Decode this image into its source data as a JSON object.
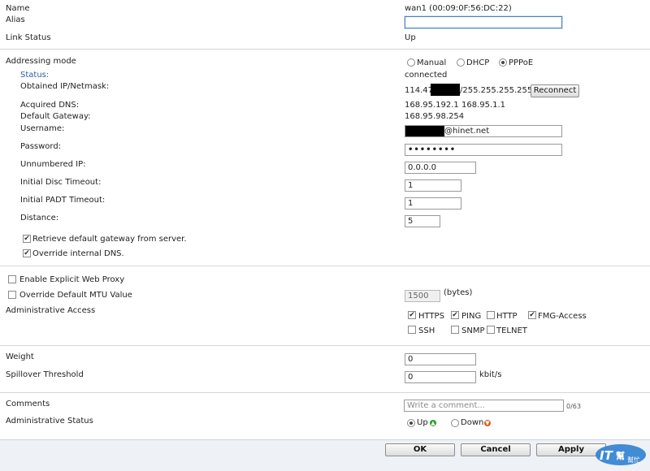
{
  "iface": {
    "name_label": "Name",
    "name_value": "wan1 (00:09:0F:56:DC:22)",
    "alias_label": "Alias",
    "alias_value": "",
    "link_label": "Link Status",
    "link_value": "Up"
  },
  "addressing": {
    "label": "Addressing mode",
    "modes": [
      "Manual",
      "DHCP",
      "PPPoE"
    ],
    "selected": "PPPoE",
    "status_label": "Status:",
    "status_value": "connected",
    "obtained_label": "Obtained IP/Netmask:",
    "obtained_prefix": "114.47.",
    "obtained_suffix": "/255.255.255.255",
    "reconnect_label": "Reconnect",
    "dns_label": "Acquired DNS:",
    "dns_value": "168.95.192.1  168.95.1.1",
    "gateway_label": "Default Gateway:",
    "gateway_value": "168.95.98.254",
    "username_label": "Username:",
    "username_suffix": "@hinet.net",
    "password_label": "Password:",
    "password_value": "••••••••",
    "unnumbered_label": "Unnumbered IP:",
    "unnumbered_value": "0.0.0.0",
    "disc_label": "Initial Disc Timeout:",
    "disc_value": "1",
    "padt_label": "Initial PADT Timeout:",
    "padt_value": "1",
    "distance_label": "Distance:",
    "distance_value": "5",
    "retrieve_gw_label": "Retrieve default gateway from server.",
    "retrieve_gw_checked": true,
    "override_dns_label": "Override internal DNS.",
    "override_dns_checked": true
  },
  "proxy": {
    "explicit_label": "Enable Explicit Web Proxy",
    "explicit_checked": false,
    "mtu_label": "Override Default MTU Value",
    "mtu_checked": false,
    "mtu_value": "1500",
    "mtu_unit": "(bytes)"
  },
  "admin_access": {
    "label": "Administrative Access",
    "items": [
      {
        "label": "HTTPS",
        "checked": true
      },
      {
        "label": "PING",
        "checked": true
      },
      {
        "label": "HTTP",
        "checked": false
      },
      {
        "label": "FMG-Access",
        "checked": true
      },
      {
        "label": "SSH",
        "checked": false
      },
      {
        "label": "SNMP",
        "checked": false
      },
      {
        "label": "TELNET",
        "checked": false
      }
    ]
  },
  "balance": {
    "weight_label": "Weight",
    "weight_value": "0",
    "spill_label": "Spillover Threshold",
    "spill_value": "0",
    "spill_unit": "kbit/s"
  },
  "comments": {
    "label": "Comments",
    "placeholder": "Write a comment...",
    "count": "0/63"
  },
  "status": {
    "label": "Administrative Status",
    "up_label": "Up",
    "down_label": "Down",
    "selected": "Up",
    "up_color": "#2a9d2a",
    "down_color": "#e05a1a"
  },
  "footer": {
    "ok_label": "OK",
    "cancel_label": "Cancel",
    "apply_label": "Apply",
    "watermark": "IT 幫幫忙"
  }
}
